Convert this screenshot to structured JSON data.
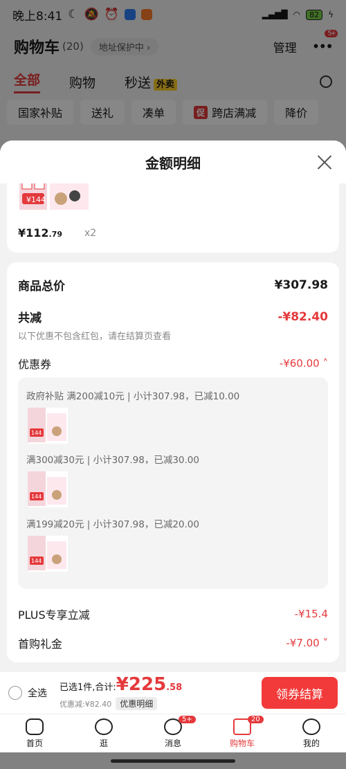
{
  "status": {
    "time": "晚上8:41",
    "battery": "82"
  },
  "header": {
    "title": "购物车",
    "count": "(20)",
    "address_pill": "地址保护中 ›",
    "manage": "管理",
    "more_badge": "5+"
  },
  "tabs": {
    "all": "全部",
    "shopping": "购物",
    "flash": "秒送",
    "waimai": "外卖"
  },
  "chips": [
    "国家补贴",
    "送礼",
    "凑单",
    "促",
    "跨店满减",
    "降价"
  ],
  "sheet": {
    "title": "金额明细",
    "product": {
      "price_int": "¥112",
      "price_dec": ".79",
      "qty": "x2"
    },
    "total_label": "商品总价",
    "total_value": "¥307.98",
    "reduce_label": "共减",
    "reduce_value": "-¥82.40",
    "note": "以下优惠不包含红包，请在结算页查看",
    "coupon_label": "优惠券",
    "coupon_value": "-¥60.00",
    "coupon_lines": [
      "政府补贴 满200减10元 | 小计307.98，已减10.00",
      "满300减30元 | 小计307.98，已减30.00",
      "满199减20元 | 小计307.98，已减20.00"
    ],
    "plus_label": "PLUS专享立减",
    "plus_value": "-¥15.4",
    "gift_label": "首购礼金",
    "gift_value": "-¥7.00"
  },
  "checkout": {
    "select_all": "全选",
    "selected": "已选1件,合计:",
    "price_int": "¥225",
    "price_dec": ".58",
    "saved": "优惠减:¥82.40",
    "detail": "优惠明细",
    "pay": "领券结算"
  },
  "tabbar": [
    {
      "label": "首页"
    },
    {
      "label": "逛"
    },
    {
      "label": "消息",
      "badge": "5+"
    },
    {
      "label": "购物车",
      "badge": "20"
    },
    {
      "label": "我的"
    }
  ],
  "colors": {
    "accent": "#e4393c",
    "pay": "#f23a3a"
  },
  "icons": [
    "close-icon",
    "search-icon",
    "more-dots-icon",
    "radio-icon"
  ]
}
